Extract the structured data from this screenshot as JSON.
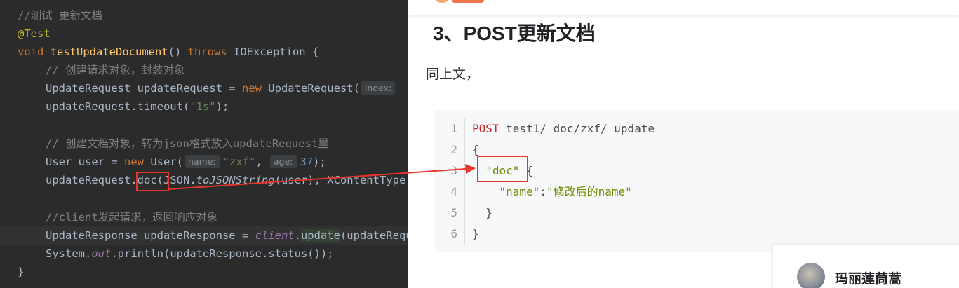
{
  "ide": {
    "lines": {
      "l0": "//测试 更新文档",
      "l1": "@Test",
      "l2_kw": "void",
      "l2_fn": "testUpdateDocument",
      "l2_mid": "() ",
      "l2_throws": "throws",
      "l2_rest": " IOException {",
      "l3": "// 创建请求对象，封装对象",
      "l4_a": "UpdateRequest updateRequest = ",
      "l4_new": "new",
      "l4_b": " UpdateRequest(",
      "l4_hint": "index:",
      "l5_a": "updateRequest.timeout(",
      "l5_str": "\"1s\"",
      "l5_b": ");",
      "l7": "// 创建文档对象，转为json格式放入updateRequest里",
      "l8_a": "User user = ",
      "l8_new": "new",
      "l8_b": " User(",
      "l8_hint1": "name:",
      "l8_str": "\"zxf\"",
      "l8_c": ", ",
      "l8_hint2": "age:",
      "l8_num": "37",
      "l8_d": ");",
      "l9_a": "updateRequest.",
      "l9_doc": "doc",
      "l9_b": "(JSON.",
      "l9_static": "toJSONString",
      "l9_c": "(user), XContentType.JSON);",
      "l11": "//client发起请求，返回响应对象",
      "l12_a": "UpdateResponse updateResponse = ",
      "l12_client": "client",
      "l12_dot": ".",
      "l12_update": "update",
      "l12_b": "(updateRequest, RequestOptions.DEFAULT);",
      "l13_a": "System.",
      "l13_out": "out",
      "l13_b": ".println(updateResponse.status());",
      "l14": "}"
    }
  },
  "article": {
    "heading": "3、POST更新文档",
    "paragraph": "同上文，",
    "code": {
      "line_numbers": [
        "1",
        "2",
        "3",
        "4",
        "5",
        "6"
      ],
      "l1_kw": "POST",
      "l1_rest": " test1/_doc/zxf/_update",
      "l2": "{",
      "l3_indent": "  ",
      "l3_str": "\"doc\"",
      "l3_rest": " {",
      "l4_indent": "    ",
      "l4_key": "\"name\"",
      "l4_colon": ":",
      "l4_val": "\"修改后的name\"",
      "l5": "  }",
      "l6": "}"
    },
    "author": {
      "name": "玛丽莲茼蒿"
    }
  },
  "colors": {
    "annotation_red": "#e8352b",
    "ide_background": "#2b2b2b",
    "code_background": "#f6f8fa"
  },
  "icons": {
    "avatar": "user-avatar-photo"
  }
}
